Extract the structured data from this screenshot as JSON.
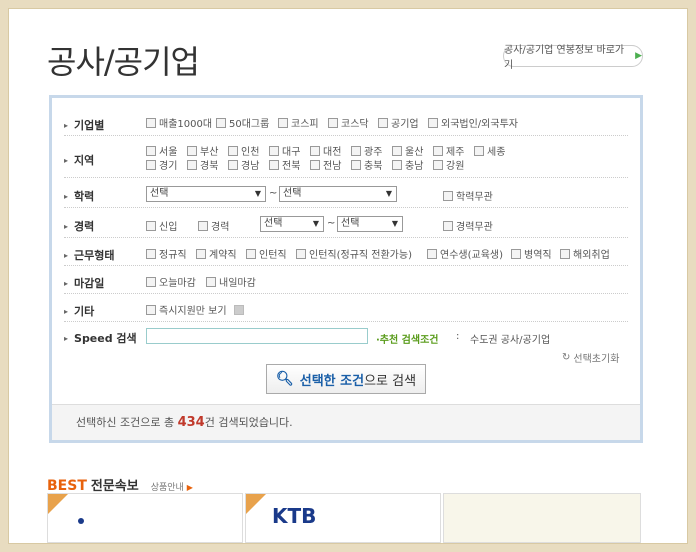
{
  "page": {
    "title": "공사/공기업",
    "top_link": "공사/공기업 연봉정보 바로가기"
  },
  "filters": {
    "company_type": {
      "label": "기업별",
      "options": [
        "매출1000대",
        "50대그룹",
        "코스피",
        "코스닥",
        "공기업",
        "외국법인/외국투자"
      ]
    },
    "region": {
      "label": "지역",
      "options": [
        "서울",
        "부산",
        "인천",
        "대구",
        "대전",
        "광주",
        "울산",
        "제주",
        "세종",
        "경기",
        "경북",
        "경남",
        "전북",
        "전남",
        "충북",
        "충남",
        "강원"
      ]
    },
    "education": {
      "label": "학력",
      "select_from": "선택",
      "select_to": "선택",
      "tilde": "~",
      "no_matter": "학력무관"
    },
    "career": {
      "label": "경력",
      "options": [
        "신입",
        "경력"
      ],
      "select_from": "선택",
      "select_to": "선택",
      "tilde": "~",
      "no_matter": "경력무관"
    },
    "employment": {
      "label": "근무형태",
      "options": [
        "정규직",
        "계약직",
        "인턴직",
        "인턴직(정규직 전환가능)",
        "연수생(교육생)",
        "병역직",
        "해외취업"
      ]
    },
    "deadline": {
      "label": "마감일",
      "options": [
        "오늘마감",
        "내일마감"
      ]
    },
    "etc": {
      "label": "기타",
      "options": [
        "즉시지원만 보기"
      ]
    },
    "speed": {
      "label": "Speed 검색",
      "input_value": "",
      "recommend_label": "·추천 검색조건",
      "recommend_sep": ":",
      "recommend_value": "수도권 공사/공기업"
    },
    "reset_label": "선택초기화"
  },
  "search_button": {
    "strong": "선택한 조건",
    "rest": "으로 검색"
  },
  "result": {
    "prefix": "선택하신 조건으로 총",
    "count": "434",
    "suffix": "건 검색되었습니다."
  },
  "best": {
    "highlight": "BEST",
    "title": "전문속보",
    "guide": "상품안내"
  },
  "cards": {
    "second_logo": "KTB"
  },
  "colors": {
    "accent_blue": "#1a5fa8",
    "accent_orange": "#e8620c",
    "count_red": "#c0392b",
    "recommend_green": "#5a9c1c"
  }
}
